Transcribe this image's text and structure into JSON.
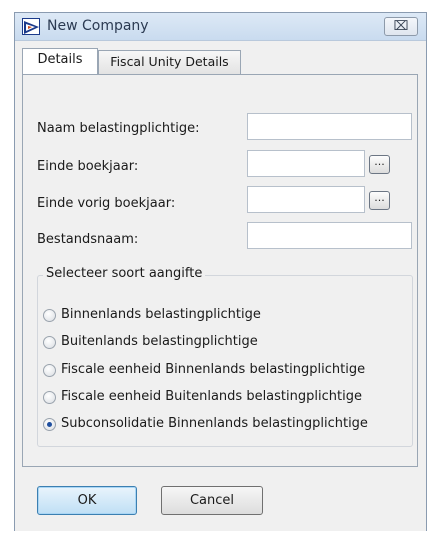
{
  "window": {
    "title": "New Company",
    "close_glyph": "⌧",
    "icon": "app-logo-icon"
  },
  "tabs": [
    {
      "label": "Details",
      "active": true
    },
    {
      "label": "Fiscal Unity Details",
      "active": false
    }
  ],
  "form": {
    "fields": [
      {
        "label": "Naam belastingplichtige:",
        "value": "",
        "has_browse": false
      },
      {
        "label": "Einde boekjaar:",
        "value": "",
        "has_browse": true
      },
      {
        "label": "Einde vorig boekjaar:",
        "value": "",
        "has_browse": true
      },
      {
        "label": "Bestandsnaam:",
        "value": "",
        "has_browse": false
      }
    ],
    "browse_label": "..."
  },
  "aangifte": {
    "title": "Selecteer soort aangifte",
    "options": [
      {
        "label": "Binnenlands belastingplichtige",
        "selected": false
      },
      {
        "label": "Buitenlands belastingplichtige",
        "selected": false
      },
      {
        "label": "Fiscale eenheid Binnenlands belastingplichtige",
        "selected": false
      },
      {
        "label": "Fiscale eenheid Buitenlands belastingplichtige",
        "selected": false
      },
      {
        "label": "Subconsolidatie Binnenlands belastingplichtige",
        "selected": true
      }
    ]
  },
  "buttons": {
    "ok": "OK",
    "cancel": "Cancel"
  },
  "colors": {
    "window_bg": "#f0f0f0",
    "titlebar": "#c9dbef",
    "ok_accent": "#bfdff5",
    "radio_dot": "#1f4f9f"
  }
}
